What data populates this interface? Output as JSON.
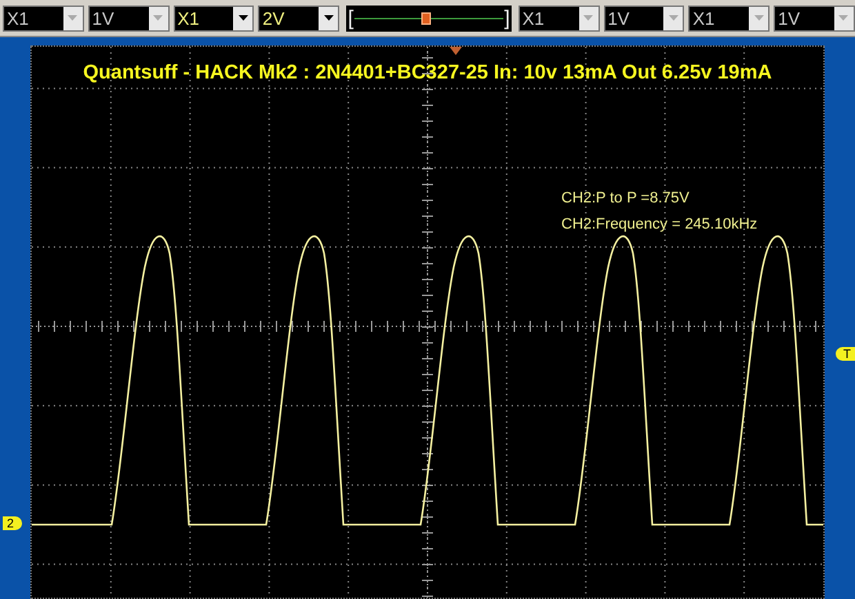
{
  "toolbar": {
    "controls": [
      {
        "kind": "dropdown",
        "value": "X1",
        "disabled": true
      },
      {
        "kind": "dropdown",
        "value": "1V",
        "disabled": true
      },
      {
        "kind": "dropdown",
        "value": "X1",
        "disabled": false
      },
      {
        "kind": "dropdown",
        "value": "2V",
        "disabled": false
      },
      {
        "kind": "slider",
        "left": "[",
        "right": "]",
        "level": 0.48
      },
      {
        "kind": "dropdown",
        "value": "X1",
        "disabled": true
      },
      {
        "kind": "dropdown",
        "value": "1V",
        "disabled": true
      },
      {
        "kind": "dropdown",
        "value": "X1",
        "disabled": true
      },
      {
        "kind": "dropdown",
        "value": "1V",
        "disabled": true
      }
    ]
  },
  "scope": {
    "title": "Quantsuff - HACK Mk2 : 2N4401+BC327-25 In: 10v 13mA Out 6.25v 19mA",
    "measurements": [
      "CH2:P to P =8.75V",
      "CH2:Frequency = 245.10kHz"
    ],
    "channel_marker": "2",
    "trigger_marker": "T"
  }
}
